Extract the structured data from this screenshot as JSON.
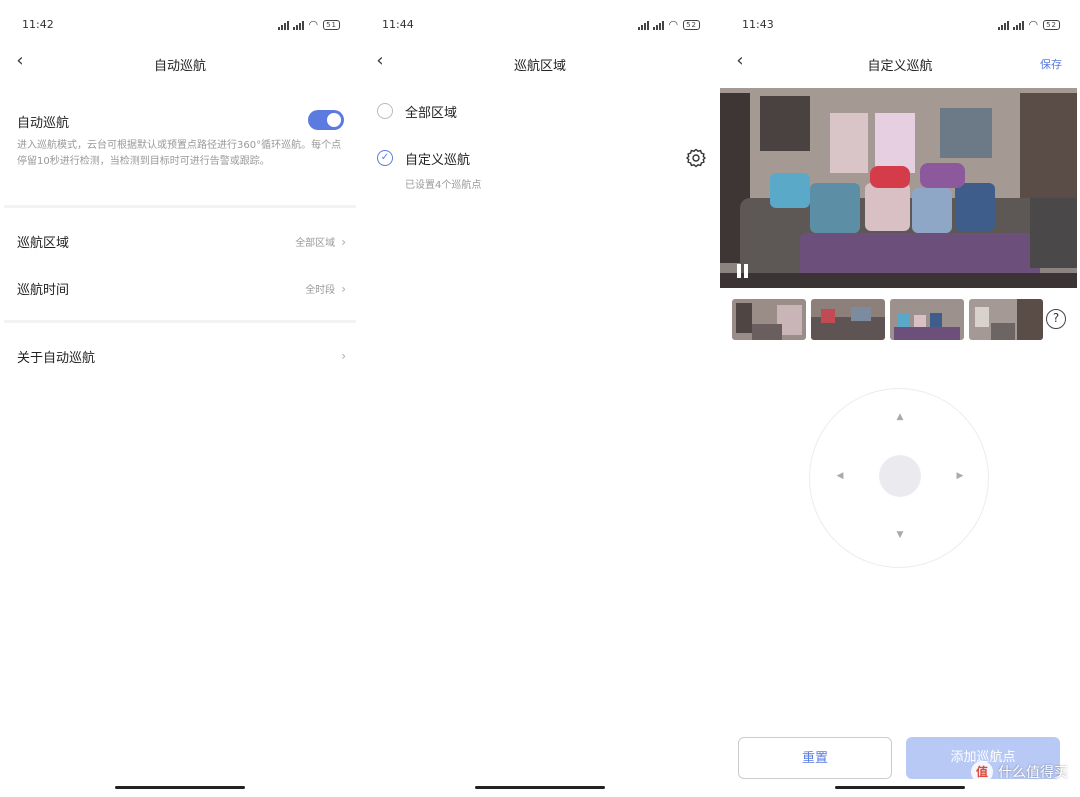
{
  "screen1": {
    "status_time": "11:42",
    "battery": "51",
    "title": "自动巡航",
    "auto_cruise_label": "自动巡航",
    "auto_cruise_enabled": true,
    "description": "进入巡航模式，云台可根据默认或预置点路径进行360°循环巡航。每个点停留10秒进行检测，当检测到目标时可进行告警或跟踪。",
    "cruise_area_label": "巡航区域",
    "cruise_area_value": "全部区域",
    "cruise_time_label": "巡航时间",
    "cruise_time_value": "全时段",
    "about_label": "关于自动巡航"
  },
  "screen2": {
    "status_time": "11:44",
    "battery": "52",
    "title": "巡航区域",
    "options": [
      {
        "label": "全部区域",
        "checked": false
      },
      {
        "label": "自定义巡航",
        "checked": true,
        "sub": "已设置4个巡航点"
      }
    ]
  },
  "screen3": {
    "status_time": "11:43",
    "battery": "52",
    "title": "自定义巡航",
    "save_label": "保存",
    "reset_label": "重置",
    "add_point_label": "添加巡航点",
    "help_symbol": "?"
  },
  "watermark": {
    "logo_text": "值",
    "text": "什么值得买"
  },
  "colors": {
    "accent": "#5b7be0",
    "accent_disabled": "#b9c9f5"
  }
}
